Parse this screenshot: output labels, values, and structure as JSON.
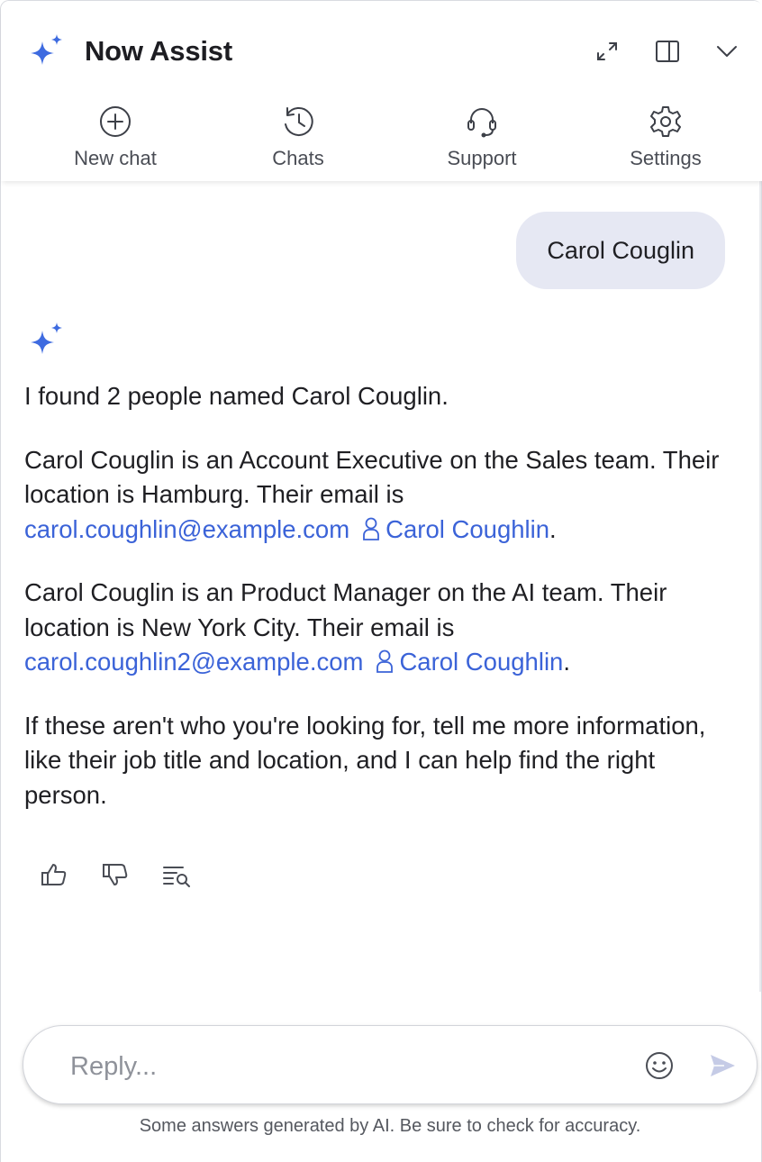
{
  "app": {
    "title": "Now Assist",
    "accent_color": "#3b63d8",
    "icons": [
      "sparkle-icon",
      "expand-icon",
      "side-panel-icon",
      "chevron-down-icon"
    ]
  },
  "nav": {
    "items": [
      {
        "label": "New chat",
        "icon": "plus-circle-icon"
      },
      {
        "label": "Chats",
        "icon": "history-icon"
      },
      {
        "label": "Support",
        "icon": "headset-icon"
      },
      {
        "label": "Settings",
        "icon": "gear-icon"
      }
    ]
  },
  "conversation": {
    "user_message": "Carol Couglin",
    "bot": {
      "intro": "I found 2 people named Carol Couglin.",
      "results": [
        {
          "text": "Carol Couglin is an Account Executive on the Sales team. Their location is Hamburg. Their email is ",
          "email": "carol.coughlin@example.com",
          "profile_link": "Carol Coughlin",
          "end": "."
        },
        {
          "text": "Carol Couglin is an Product Manager on the AI team. Their location is New York City. Their email is ",
          "email": "carol.coughlin2@example.com",
          "profile_link": "Carol Coughlin",
          "end": "."
        }
      ],
      "closing": "If these aren't who you're looking for, tell me more information, like their job title and location, and I can help find the right person."
    },
    "feedback_icons": [
      "thumbs-up-icon",
      "thumbs-down-icon",
      "sources-icon"
    ]
  },
  "composer": {
    "placeholder": "Reply...",
    "value": ""
  },
  "footer": {
    "disclaimer": "Some answers generated by AI. Be sure to check for accuracy."
  }
}
